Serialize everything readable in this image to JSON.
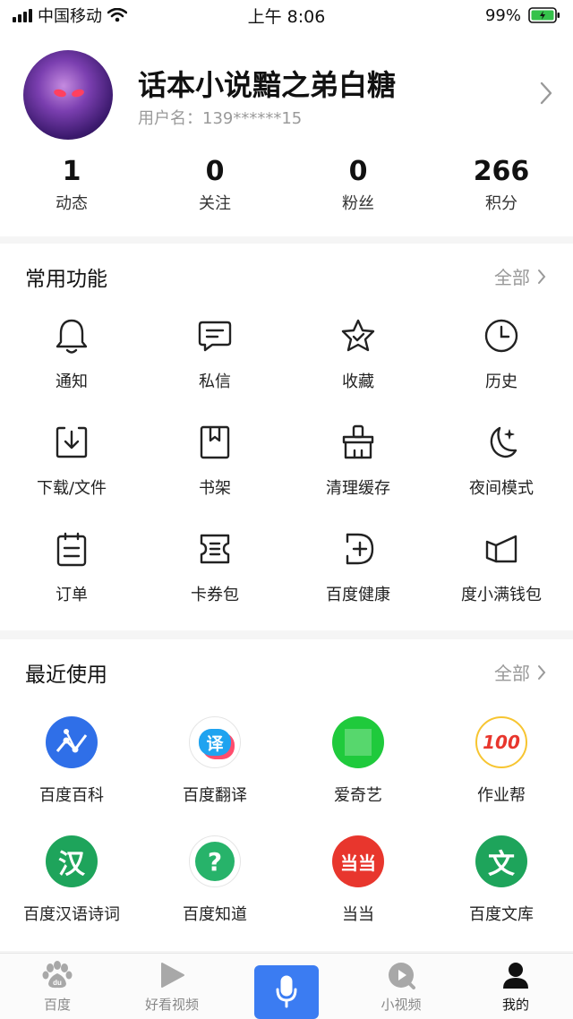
{
  "status_bar": {
    "carrier": "中国移动",
    "time": "上午 8:06",
    "battery": "99%"
  },
  "profile": {
    "name": "话本小说黯之弟白糖",
    "user_id": "用户名：139******15",
    "stats": [
      {
        "value": "1",
        "label": "动态"
      },
      {
        "value": "0",
        "label": "关注"
      },
      {
        "value": "0",
        "label": "粉丝"
      },
      {
        "value": "266",
        "label": "积分"
      }
    ]
  },
  "common": {
    "title": "常用功能",
    "more": "全部",
    "items": [
      {
        "label": "通知",
        "icon": "bell-icon"
      },
      {
        "label": "私信",
        "icon": "message-icon"
      },
      {
        "label": "收藏",
        "icon": "star-icon"
      },
      {
        "label": "历史",
        "icon": "clock-icon"
      },
      {
        "label": "下载/文件",
        "icon": "download-icon"
      },
      {
        "label": "书架",
        "icon": "bookmark-icon"
      },
      {
        "label": "清理缓存",
        "icon": "broom-icon"
      },
      {
        "label": "夜间模式",
        "icon": "moon-icon"
      },
      {
        "label": "订单",
        "icon": "order-icon"
      },
      {
        "label": "卡券包",
        "icon": "coupon-icon"
      },
      {
        "label": "百度健康",
        "icon": "health-icon"
      },
      {
        "label": "度小满钱包",
        "icon": "wallet-icon"
      }
    ]
  },
  "recent": {
    "title": "最近使用",
    "more": "全部",
    "items": [
      {
        "label": "百度百科",
        "icon": "baike-icon",
        "color": "#2f6fe8",
        "glyph": ""
      },
      {
        "label": "百度翻译",
        "icon": "fanyi-icon",
        "color": "#ffffff",
        "glyph": "译"
      },
      {
        "label": "爱奇艺",
        "icon": "iqiyi-icon",
        "color": "#1fca3c",
        "glyph": ""
      },
      {
        "label": "作业帮",
        "icon": "zuoyebang-icon",
        "color": "#ffffff",
        "glyph": "100"
      },
      {
        "label": "百度汉语诗词",
        "icon": "hanyu-icon",
        "color": "#1ea45b",
        "glyph": "汉"
      },
      {
        "label": "百度知道",
        "icon": "zhidao-icon",
        "color": "#27b36a",
        "glyph": "?"
      },
      {
        "label": "当当",
        "icon": "dangdang-icon",
        "color": "#e8362d",
        "glyph": "当当"
      },
      {
        "label": "百度文库",
        "icon": "wenku-icon",
        "color": "#1ea45b",
        "glyph": "文"
      }
    ]
  },
  "nav": {
    "items": [
      {
        "label": "百度",
        "icon": "baidu-paw-icon"
      },
      {
        "label": "好看视频",
        "icon": "play-icon"
      },
      {
        "label": "",
        "icon": "microphone-icon"
      },
      {
        "label": "小视频",
        "icon": "short-video-icon"
      },
      {
        "label": "我的",
        "icon": "person-icon"
      }
    ]
  },
  "colors": {
    "accent": "#3b7cf2",
    "muted": "#999999"
  }
}
